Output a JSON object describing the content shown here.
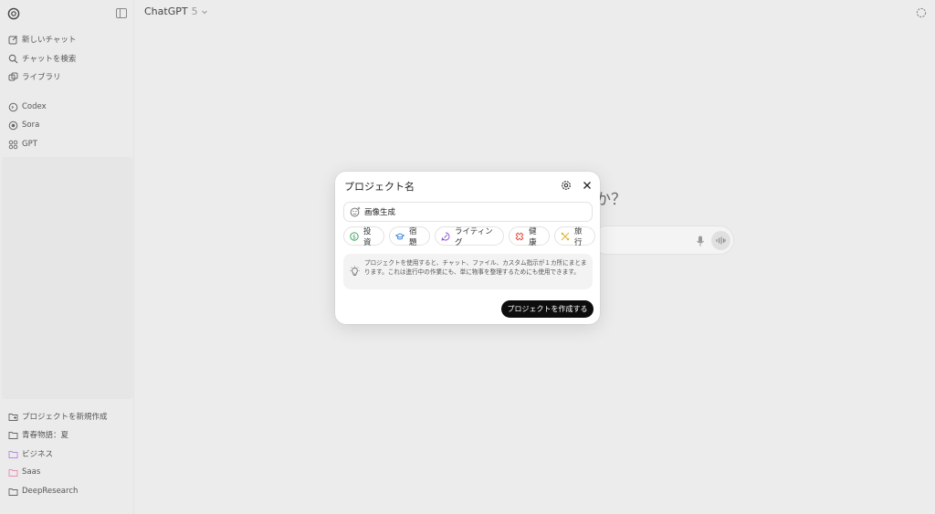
{
  "sidebar": {
    "nav": [
      {
        "label": "新しいチャット",
        "icon": "edit-icon"
      },
      {
        "label": "チャットを検索",
        "icon": "search-icon"
      },
      {
        "label": "ライブラリ",
        "icon": "library-icon"
      }
    ],
    "apps": [
      {
        "label": "Codex",
        "icon": "codex-icon"
      },
      {
        "label": "Sora",
        "icon": "sora-icon"
      },
      {
        "label": "GPT",
        "icon": "grid-icon"
      }
    ],
    "projects": [
      {
        "label": "プロジェクトを新規作成",
        "icon": "folder-plus-icon"
      },
      {
        "label": "青春物語：夏",
        "icon": "folder-icon"
      },
      {
        "label": "ビジネス",
        "icon": "folder-icon",
        "color": "#b58adf"
      },
      {
        "label": "Saas",
        "icon": "folder-icon",
        "color": "#e98bb5"
      },
      {
        "label": "DeepResearch",
        "icon": "folder-icon"
      }
    ]
  },
  "header": {
    "model": "ChatGPT",
    "version": "5"
  },
  "background": {
    "heading_fragment": "か？"
  },
  "dialog": {
    "title": "プロジェクト名",
    "name_value": "画像生成",
    "chips": [
      {
        "label": "投資",
        "icon": "dollar-icon",
        "color": "#2e9e55"
      },
      {
        "label": "宿題",
        "icon": "graduation-cap-icon",
        "color": "#2f7fd6"
      },
      {
        "label": "ライティング",
        "icon": "pen-bubble-icon",
        "color": "#8c4fd6"
      },
      {
        "label": "健康",
        "icon": "health-icon",
        "color": "#e0443a"
      },
      {
        "label": "旅行",
        "icon": "plane-icon",
        "color": "#e3b021"
      }
    ],
    "info": "プロジェクトを使用すると、チャット、ファイル、カスタム指示が１カ所にまとまります。これは進行中の作業にも、単に物事を整理するためにも使用できます。",
    "create_label": "プロジェクトを作成する"
  }
}
